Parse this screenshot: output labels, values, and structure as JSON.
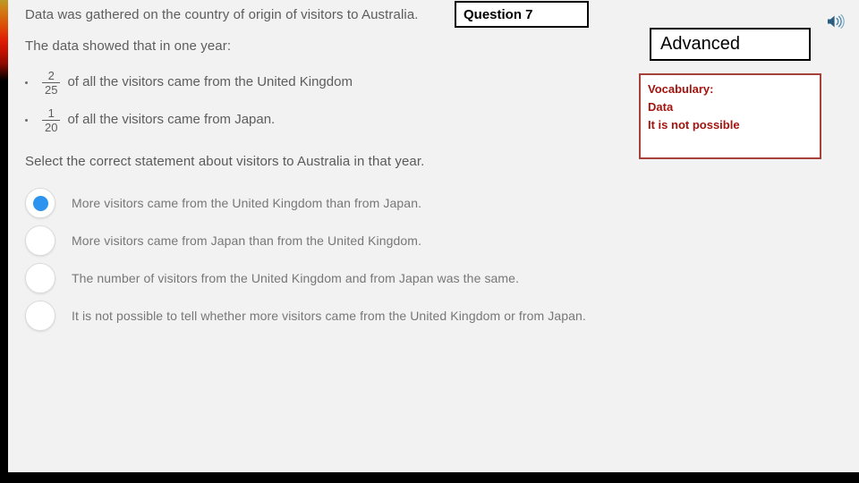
{
  "slide": {
    "background_color": "#f2f2f2",
    "accent_strip_colors": [
      "#b99a2a",
      "#dd4a06",
      "#e01f03",
      "#000000"
    ],
    "bottom_bar_color": "#000000"
  },
  "question": {
    "number_label": "Question 7",
    "level_label": "Advanced",
    "stem": [
      "Data was gathered on the country of origin of visitors to Australia.",
      "The data showed that in one year:"
    ],
    "bullets": [
      {
        "numerator": "2",
        "denominator": "25",
        "text": "of all the visitors came from the United Kingdom"
      },
      {
        "numerator": "1",
        "denominator": "20",
        "text": "of all the visitors came from Japan."
      }
    ],
    "prompt": "Select the correct statement about visitors to Australia in that year.",
    "options": [
      {
        "label": "More visitors came from the United Kingdom than from Japan.",
        "selected": true
      },
      {
        "label": "More visitors came from Japan than from the United Kingdom.",
        "selected": false
      },
      {
        "label": "The number of visitors from the United Kingdom and from Japan was the same.",
        "selected": false
      },
      {
        "label": "It is not possible to tell whether more visitors came from the United Kingdom or from Japan.",
        "selected": false
      }
    ],
    "selected_color": "#2c93ee"
  },
  "vocabulary": {
    "heading": "Vocabulary:",
    "terms": [
      "Data",
      "It is not possible"
    ],
    "border_color": "#a6423a",
    "text_color": "#a3140f"
  },
  "icons": {
    "speaker": "speaker-icon"
  }
}
